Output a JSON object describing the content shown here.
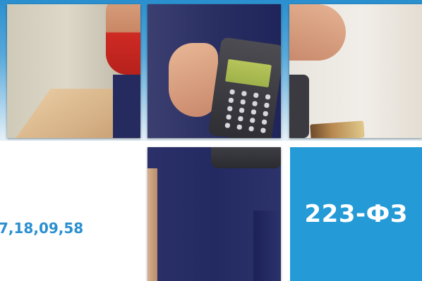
{
  "date_text": "7,18,09,58",
  "badge": {
    "label": "223-ФЗ"
  },
  "colors": {
    "accent": "#249ad6",
    "date_text": "#2a8fd0",
    "background": "#ffffff"
  },
  "photo": "courier-with-card-payment-terminal"
}
